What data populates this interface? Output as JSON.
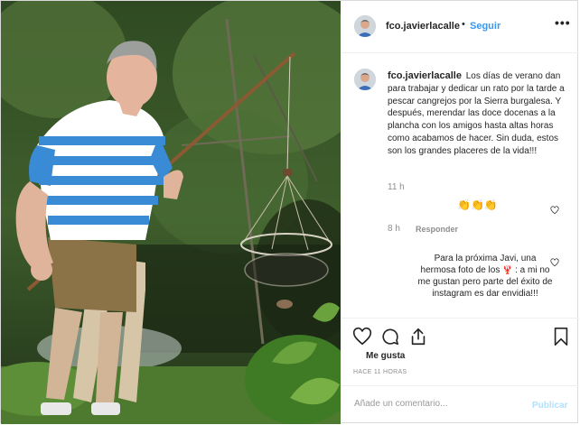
{
  "post": {
    "username": "fco.javierlacalle",
    "dot": "•",
    "follow_label": "Seguir",
    "more_icon": "ellipsis-icon",
    "more_glyph": "•••"
  },
  "caption": {
    "username": "fco.javierlacalle",
    "text": "Los días de verano dan para trabajar y dedicar un rato por la tarde a pescar cangrejos por la Sierra burgalesa. Y después, merendar las doce docenas a la plancha con los amigos hasta altas horas como acabamos de hacer. Sin duda, estos son los grandes placeres de la vida!!!",
    "time": "11 h"
  },
  "comments": [
    {
      "text": "👏👏👏",
      "time": "8 h",
      "reply_label": "Responder"
    },
    {
      "text_before": "Para la próxima Javi, una hermosa foto de los",
      "emoji": "🦞",
      "text_after": ": a mi no me gustan pero parte del éxito de instagram es dar envidia!!!"
    }
  ],
  "actions": {
    "like_icon": "heart-outline-icon",
    "comment_icon": "comment-icon",
    "share_icon": "share-icon",
    "save_icon": "bookmark-icon",
    "likes_label": "Me gusta",
    "ago_label": "HACE 11 HORAS"
  },
  "add_comment": {
    "placeholder": "Añade un comentario...",
    "publish_label": "Publicar"
  },
  "colors": {
    "link_blue": "#3897f0",
    "publish_disabled": "#b2dffc",
    "muted_text": "#8e8e8e"
  }
}
